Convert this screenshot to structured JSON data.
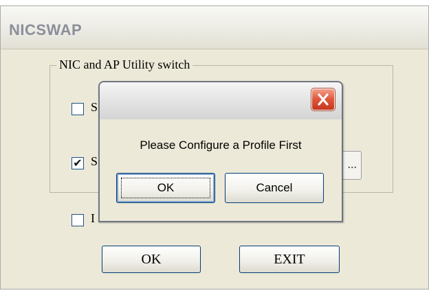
{
  "main_window": {
    "title": "NICSWAP",
    "group": {
      "legend": "NIC and AP Utility switch",
      "checkboxes": [
        {
          "label": "S",
          "checked": false
        },
        {
          "label": "S",
          "checked": true
        }
      ],
      "partial_button_label": "..."
    },
    "bottom_checkbox": {
      "label": "I",
      "checked": false
    },
    "buttons": {
      "ok": "OK",
      "exit": "EXIT"
    }
  },
  "dialog": {
    "message": "Please Configure a Profile First",
    "buttons": {
      "ok": "OK",
      "cancel": "Cancel"
    },
    "close_icon": "close-icon",
    "colors": {
      "close_button": "#d9533a"
    }
  },
  "check_mark": "✔"
}
